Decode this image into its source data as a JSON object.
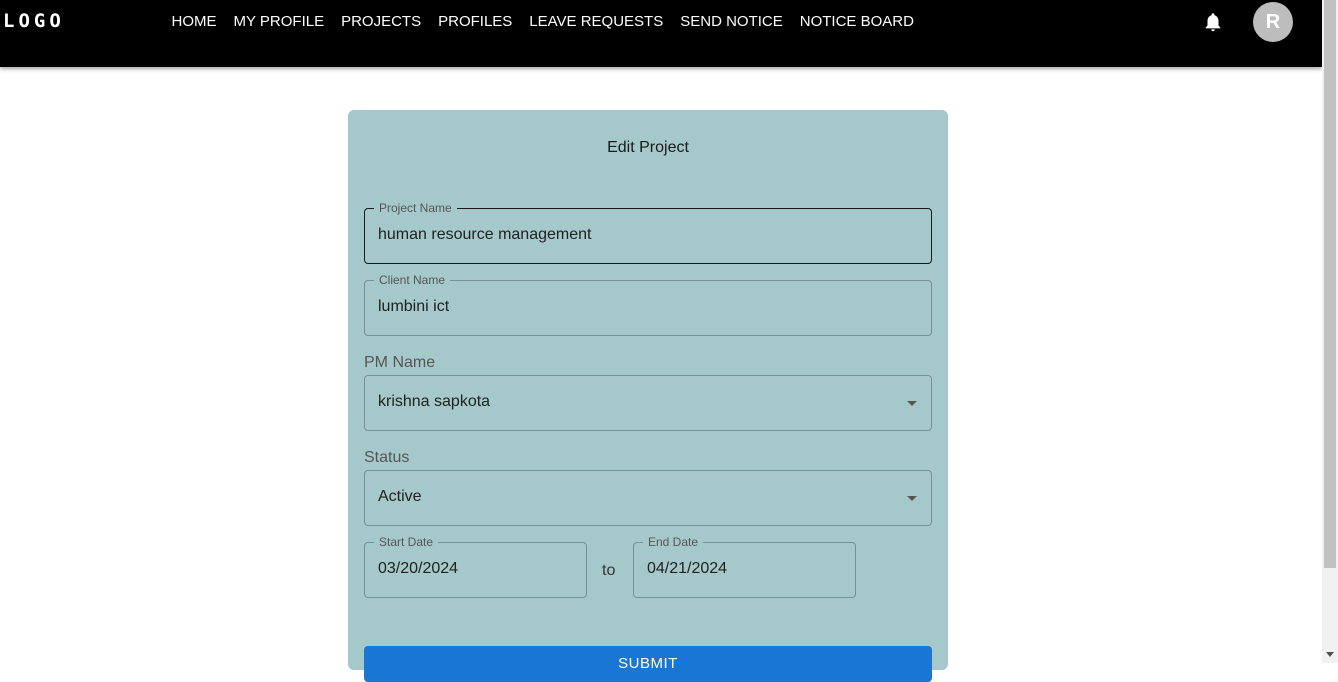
{
  "navbar": {
    "logo": "LOGO",
    "items": [
      {
        "label": "HOME"
      },
      {
        "label": "MY PROFILE"
      },
      {
        "label": "PROJECTS"
      },
      {
        "label": "PROFILES"
      },
      {
        "label": "LEAVE REQUESTS"
      },
      {
        "label": "SEND NOTICE"
      },
      {
        "label": "NOTICE BOARD"
      }
    ],
    "notification_icon": "bell-icon",
    "avatar_initial": "R"
  },
  "form": {
    "title": "Edit Project",
    "project_name": {
      "label": "Project Name",
      "value": "human resource management"
    },
    "client_name": {
      "label": "Client Name",
      "value": "lumbini ict"
    },
    "pm_name": {
      "label": "PM Name",
      "value": "krishna sapkota"
    },
    "status": {
      "label": "Status",
      "value": "Active"
    },
    "start_date": {
      "label": "Start Date",
      "value": "03/20/2024"
    },
    "to_text": "to",
    "end_date": {
      "label": "End Date",
      "value": "04/21/2024"
    },
    "submit_label": "SUBMIT"
  },
  "colors": {
    "navbar_bg": "#000000",
    "card_bg": "#a5c8ca",
    "submit_bg": "#1976d2"
  }
}
